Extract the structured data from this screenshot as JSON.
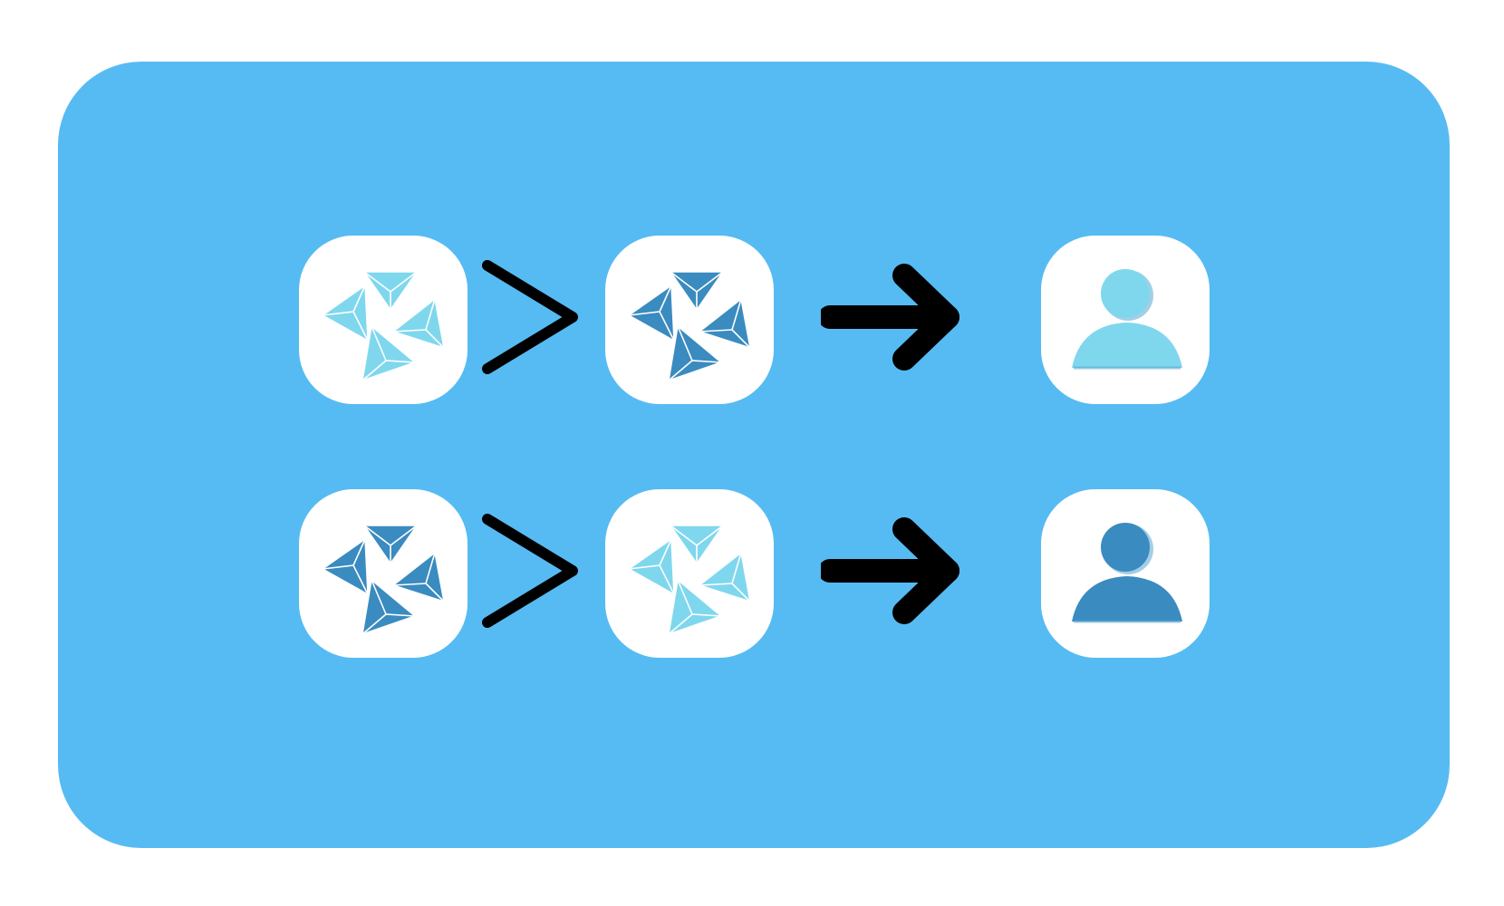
{
  "colors": {
    "background": "#56bbf2",
    "tile": "#ffffff",
    "light_blue": "#7fd7ee",
    "dark_blue": "#3a8bc0",
    "operator": "#000000"
  },
  "rows": [
    {
      "left": {
        "icon": "pinwheel-triangles-icon",
        "color": "light_blue"
      },
      "operator": "greater-than-icon",
      "right": {
        "icon": "pinwheel-triangles-icon",
        "color": "dark_blue"
      },
      "arrow": "right-arrow-icon",
      "result": {
        "icon": "person-icon",
        "color": "light_blue"
      }
    },
    {
      "left": {
        "icon": "pinwheel-triangles-icon",
        "color": "dark_blue"
      },
      "operator": "greater-than-icon",
      "right": {
        "icon": "pinwheel-triangles-icon",
        "color": "light_blue"
      },
      "arrow": "right-arrow-icon",
      "result": {
        "icon": "person-icon",
        "color": "dark_blue"
      }
    }
  ]
}
